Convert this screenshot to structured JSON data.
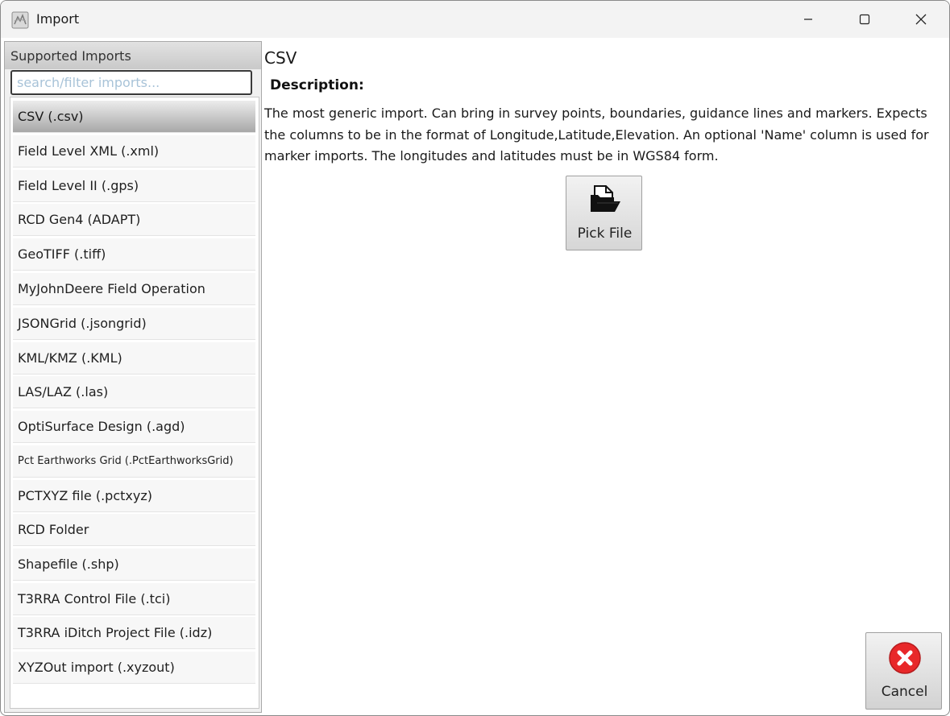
{
  "window": {
    "title": "Import"
  },
  "left_panel": {
    "header": "Supported Imports",
    "search_placeholder": "search/filter imports...",
    "items": [
      {
        "label": "CSV (.csv)",
        "selected": true
      },
      {
        "label": "Field Level XML (.xml)"
      },
      {
        "label": "Field Level II (.gps)"
      },
      {
        "label": "RCD Gen4 (ADAPT)"
      },
      {
        "label": "GeoTIFF (.tiff)"
      },
      {
        "label": "MyJohnDeere Field Operation"
      },
      {
        "label": "JSONGrid (.jsongrid)"
      },
      {
        "label": "KML/KMZ (.KML)"
      },
      {
        "label": "LAS/LAZ (.las)"
      },
      {
        "label": "OptiSurface Design (.agd)"
      },
      {
        "label": "Pct Earthworks Grid (.PctEarthworksGrid)"
      },
      {
        "label": "PCTXYZ file (.pctxyz)"
      },
      {
        "label": "RCD Folder"
      },
      {
        "label": "Shapefile (.shp)"
      },
      {
        "label": "T3RRA Control File (.tci)"
      },
      {
        "label": "T3RRA iDitch Project File (.idz)"
      },
      {
        "label": "XYZOut import (.xyzout)"
      }
    ]
  },
  "content": {
    "title": "CSV",
    "description_label": "Description:",
    "description": "The most generic import. Can bring in survey points, boundaries, guidance lines and markers. Expects the columns to be in the format of Longitude,Latitude,Elevation. An optional 'Name' column is used for marker imports. The longitudes and latitudes must be in WGS84 form."
  },
  "buttons": {
    "pick_file": "Pick File",
    "cancel": "Cancel"
  },
  "colors": {
    "cancel_icon": "#e8282a",
    "selected_item": "#a8a8a8"
  }
}
